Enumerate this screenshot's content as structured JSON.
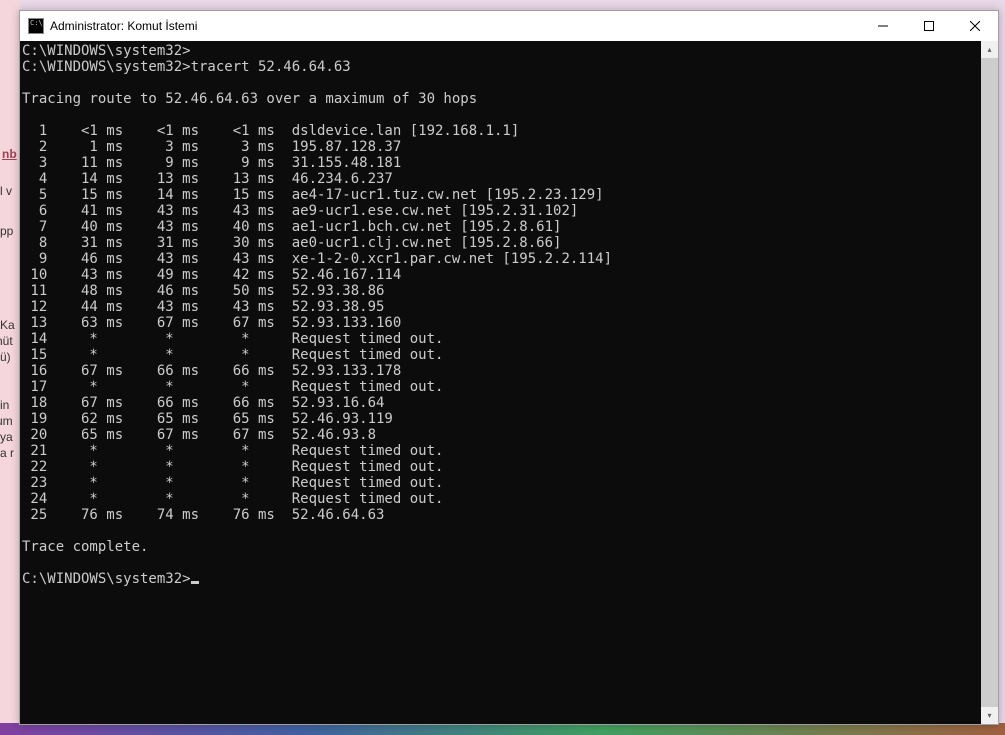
{
  "bg": {
    "link_fragment": "nb",
    "t1": "l v",
    "t2": "pp",
    "t3": "Ka",
    "t4": "nüt",
    "t5": "ü)",
    "t6": "in",
    "t7": "um",
    "t8": "ya",
    "t9": "a r"
  },
  "window": {
    "title": "Administrator: Komut İstemi"
  },
  "console": {
    "prompt": "C:\\WINDOWS\\system32>",
    "command": "tracert 52.46.64.63",
    "trace_header": "Tracing route to 52.46.64.63 over a maximum of 30 hops",
    "trace_footer": "Trace complete.",
    "hops": [
      {
        "n": 1,
        "t1": "<1 ms",
        "t2": "<1 ms",
        "t3": "<1 ms",
        "host": "dsldevice.lan [192.168.1.1]"
      },
      {
        "n": 2,
        "t1": " 1 ms",
        "t2": " 3 ms",
        "t3": " 3 ms",
        "host": "195.87.128.37"
      },
      {
        "n": 3,
        "t1": "11 ms",
        "t2": " 9 ms",
        "t3": " 9 ms",
        "host": "31.155.48.181"
      },
      {
        "n": 4,
        "t1": "14 ms",
        "t2": "13 ms",
        "t3": "13 ms",
        "host": "46.234.6.237"
      },
      {
        "n": 5,
        "t1": "15 ms",
        "t2": "14 ms",
        "t3": "15 ms",
        "host": "ae4-17-ucr1.tuz.cw.net [195.2.23.129]"
      },
      {
        "n": 6,
        "t1": "41 ms",
        "t2": "43 ms",
        "t3": "43 ms",
        "host": "ae9-ucr1.ese.cw.net [195.2.31.102]"
      },
      {
        "n": 7,
        "t1": "40 ms",
        "t2": "43 ms",
        "t3": "40 ms",
        "host": "ae1-ucr1.bch.cw.net [195.2.8.61]"
      },
      {
        "n": 8,
        "t1": "31 ms",
        "t2": "31 ms",
        "t3": "30 ms",
        "host": "ae0-ucr1.clj.cw.net [195.2.8.66]"
      },
      {
        "n": 9,
        "t1": "46 ms",
        "t2": "43 ms",
        "t3": "43 ms",
        "host": "xe-1-2-0.xcr1.par.cw.net [195.2.2.114]"
      },
      {
        "n": 10,
        "t1": "43 ms",
        "t2": "49 ms",
        "t3": "42 ms",
        "host": "52.46.167.114"
      },
      {
        "n": 11,
        "t1": "48 ms",
        "t2": "46 ms",
        "t3": "50 ms",
        "host": "52.93.38.86"
      },
      {
        "n": 12,
        "t1": "44 ms",
        "t2": "43 ms",
        "t3": "43 ms",
        "host": "52.93.38.95"
      },
      {
        "n": 13,
        "t1": "63 ms",
        "t2": "67 ms",
        "t3": "67 ms",
        "host": "52.93.133.160"
      },
      {
        "n": 14,
        "t1": "*",
        "t2": "*",
        "t3": "*",
        "host": "Request timed out."
      },
      {
        "n": 15,
        "t1": "*",
        "t2": "*",
        "t3": "*",
        "host": "Request timed out."
      },
      {
        "n": 16,
        "t1": "67 ms",
        "t2": "66 ms",
        "t3": "66 ms",
        "host": "52.93.133.178"
      },
      {
        "n": 17,
        "t1": "*",
        "t2": "*",
        "t3": "*",
        "host": "Request timed out."
      },
      {
        "n": 18,
        "t1": "67 ms",
        "t2": "66 ms",
        "t3": "66 ms",
        "host": "52.93.16.64"
      },
      {
        "n": 19,
        "t1": "62 ms",
        "t2": "65 ms",
        "t3": "65 ms",
        "host": "52.46.93.119"
      },
      {
        "n": 20,
        "t1": "65 ms",
        "t2": "67 ms",
        "t3": "67 ms",
        "host": "52.46.93.8"
      },
      {
        "n": 21,
        "t1": "*",
        "t2": "*",
        "t3": "*",
        "host": "Request timed out."
      },
      {
        "n": 22,
        "t1": "*",
        "t2": "*",
        "t3": "*",
        "host": "Request timed out."
      },
      {
        "n": 23,
        "t1": "*",
        "t2": "*",
        "t3": "*",
        "host": "Request timed out."
      },
      {
        "n": 24,
        "t1": "*",
        "t2": "*",
        "t3": "*",
        "host": "Request timed out."
      },
      {
        "n": 25,
        "t1": "76 ms",
        "t2": "74 ms",
        "t3": "76 ms",
        "host": "52.46.64.63"
      }
    ]
  }
}
